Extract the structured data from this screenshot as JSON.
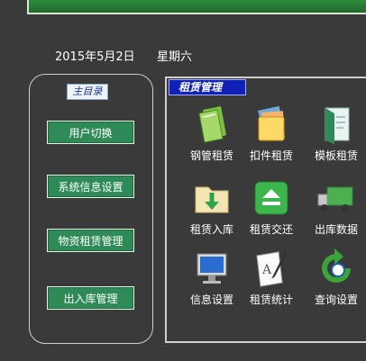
{
  "header": {
    "date": "2015年5月2日",
    "weekday": "星期六"
  },
  "sidebar": {
    "title": "主目录",
    "items": [
      {
        "label": "用户切换"
      },
      {
        "label": "系统信息设置"
      },
      {
        "label": "物资租赁管理"
      },
      {
        "label": "出入库管理"
      }
    ]
  },
  "main": {
    "title": "租赁管理",
    "tiles": [
      {
        "label": "钢管租赁",
        "icon": "green-notebook-icon"
      },
      {
        "label": "扣件租赁",
        "icon": "folders-stack-icon"
      },
      {
        "label": "模板租赁",
        "icon": "document-folder-icon"
      },
      {
        "label": "租赁入库",
        "icon": "folder-download-icon"
      },
      {
        "label": "租赁交还",
        "icon": "eject-button-icon"
      },
      {
        "label": "出库数据",
        "icon": "delivery-truck-icon"
      },
      {
        "label": "信息设置",
        "icon": "computer-monitor-icon"
      },
      {
        "label": "租赁统计",
        "icon": "pen-document-icon"
      },
      {
        "label": "查询设置",
        "icon": "green-arrow-search-icon"
      }
    ]
  },
  "colors": {
    "background": "#3a3a3a",
    "button_green": "#2e8b57",
    "title_blue": "#1020b8",
    "banner_green": "#2f8a3e"
  }
}
